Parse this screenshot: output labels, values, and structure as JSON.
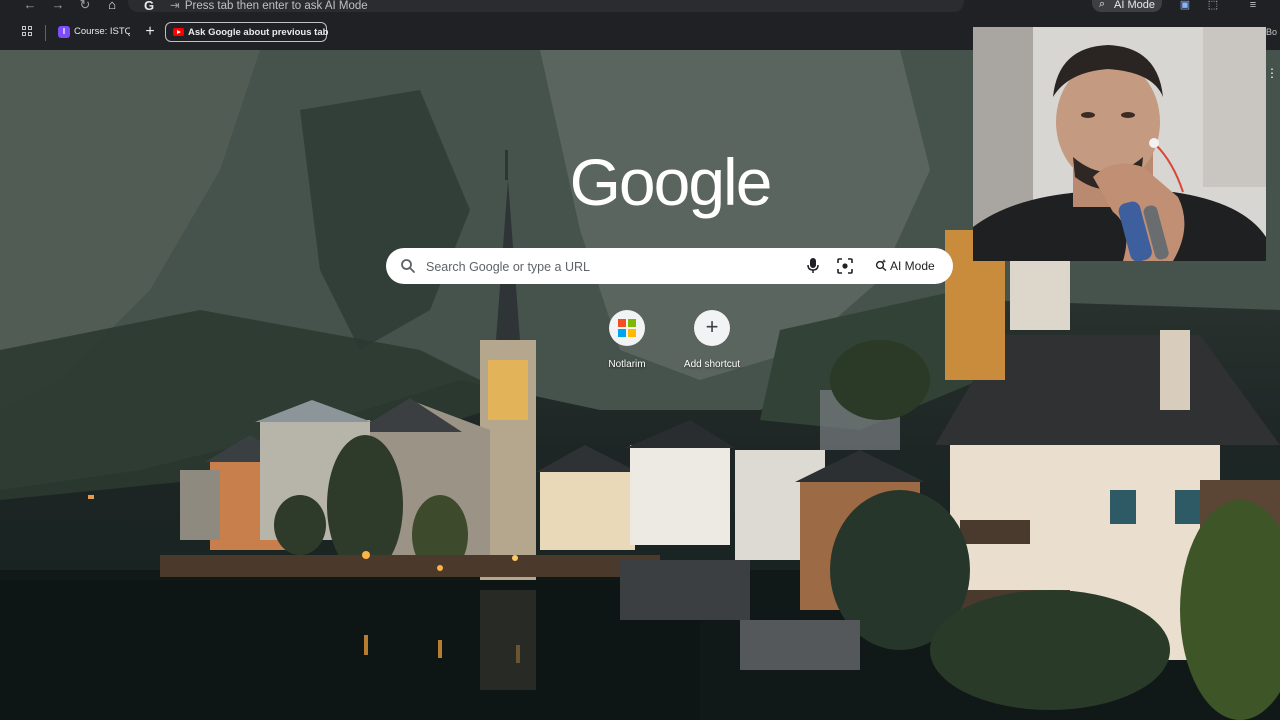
{
  "browser": {
    "omnibox": {
      "favicon_letter": "G",
      "tab_key_hint": "⇥",
      "hint_text": "Press tab then enter to ask AI Mode"
    },
    "ai_mode_chip": "AI Mode",
    "bookmark_trailing": "Bo",
    "bookmarks": {
      "course_favicon": "I",
      "course_label": "Course: ISTQ",
      "new_tab": "+",
      "ask_google_chip": "Ask Google about previous tab"
    }
  },
  "ntp": {
    "logo": "Google",
    "search": {
      "placeholder": "Search Google or type a URL",
      "ai_mode_label": "AI Mode"
    },
    "shortcuts": [
      {
        "label": "Notlarim"
      },
      {
        "label": "Add shortcut",
        "glyph": "+"
      }
    ]
  },
  "colors": {
    "chrome_bg": "#202124",
    "search_bg": "#ffffff",
    "ms_red": "#f25022",
    "ms_green": "#7fba00",
    "ms_blue": "#00a4ef",
    "ms_yellow": "#ffb900"
  },
  "icons": {
    "back": "back-arrow-icon",
    "forward": "forward-arrow-icon",
    "reload": "reload-icon",
    "home": "home-icon",
    "search": "search-icon",
    "mic": "microphone-icon",
    "lens": "google-lens-icon",
    "ai_sparkle": "ai-sparkle-search-icon",
    "apps": "apps-grid-icon"
  }
}
